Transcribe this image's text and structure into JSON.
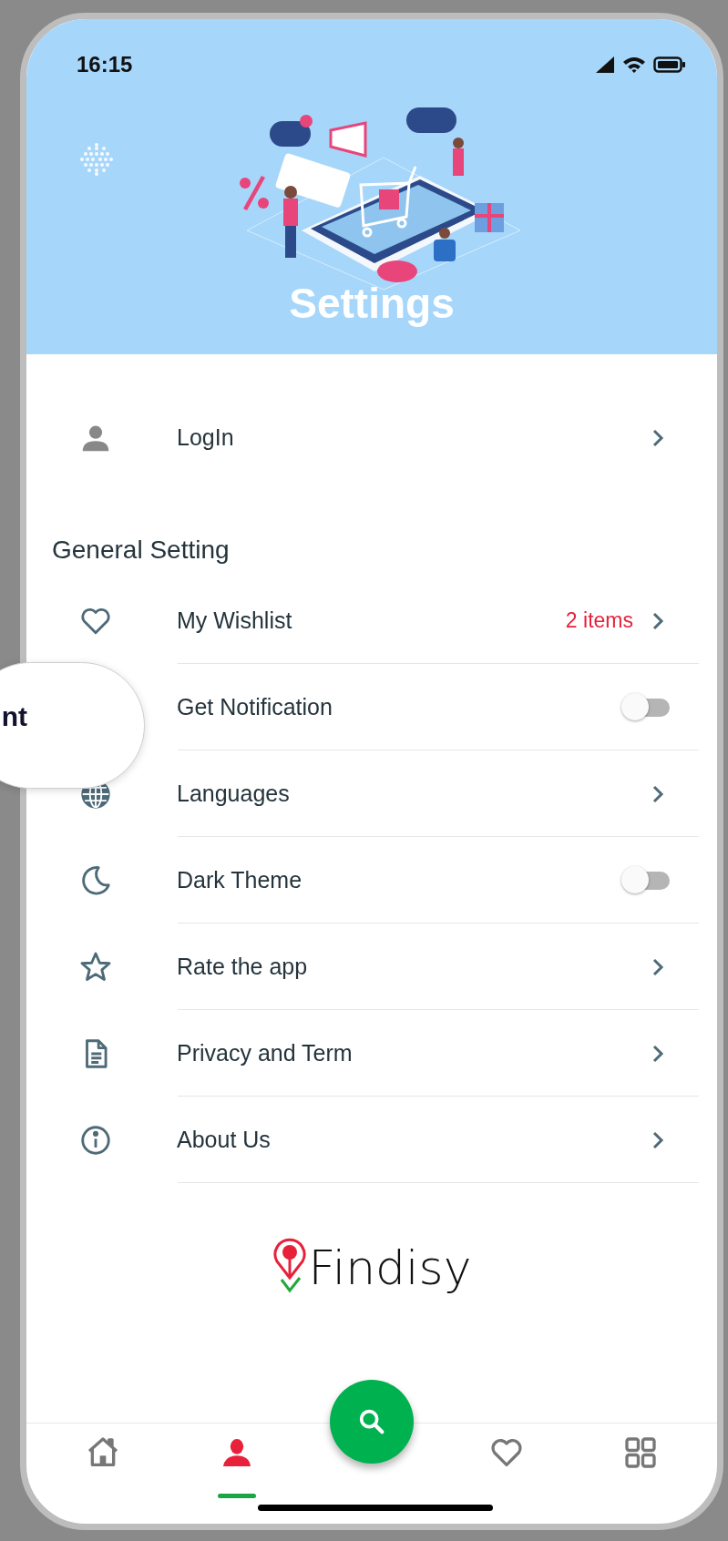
{
  "status_bar": {
    "time": "16:15"
  },
  "header": {
    "title": "Settings"
  },
  "login": {
    "label": "LogIn"
  },
  "section": {
    "title": "General Setting"
  },
  "items": [
    {
      "kind": "link",
      "label": "My Wishlist",
      "badge": "2 items"
    },
    {
      "kind": "toggle",
      "label": "Get Notification",
      "on": false
    },
    {
      "kind": "link",
      "label": "Languages"
    },
    {
      "kind": "toggle",
      "label": "Dark Theme",
      "on": false
    },
    {
      "kind": "link",
      "label": "Rate the app"
    },
    {
      "kind": "link",
      "label": "Privacy and Term"
    },
    {
      "kind": "link",
      "label": "About Us"
    }
  ],
  "logo": {
    "text": "Findisy"
  },
  "overlay": {
    "text": "nt"
  },
  "nav": [
    {
      "selected": false
    },
    {
      "selected": true
    },
    {
      "selected": false
    },
    {
      "selected": false
    },
    {
      "selected": false
    }
  ]
}
